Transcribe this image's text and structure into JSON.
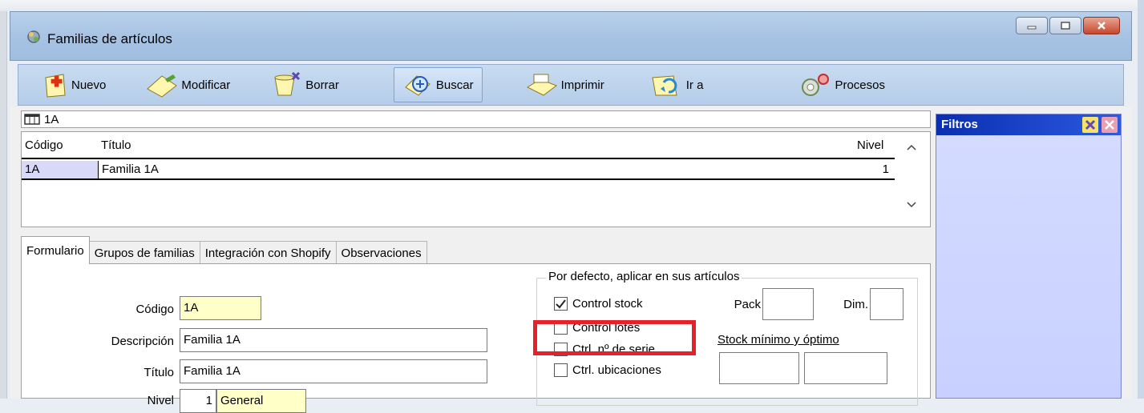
{
  "window": {
    "title": "Familias de artículos"
  },
  "toolbar": {
    "nuevo": "Nuevo",
    "modificar": "Modificar",
    "borrar": "Borrar",
    "buscar": "Buscar",
    "imprimir": "Imprimir",
    "ir_a": "Ir a",
    "procesos": "Procesos"
  },
  "search": {
    "value": "1A"
  },
  "grid": {
    "headers": {
      "codigo": "Código",
      "titulo": "Título",
      "nivel": "Nivel"
    },
    "rows": [
      {
        "codigo": "1A",
        "titulo": "Familia 1A",
        "nivel": "1"
      }
    ]
  },
  "filters": {
    "title": "Filtros"
  },
  "tabs": [
    "Formulario",
    "Grupos de familias",
    "Integración con Shopify",
    "Observaciones"
  ],
  "form": {
    "codigo_label": "Código",
    "codigo_value": "1A",
    "descripcion_label": "Descripción",
    "descripcion_value": "Familia 1A",
    "titulo_label": "Título",
    "titulo_value": "Familia 1A",
    "nivel_label": "Nivel",
    "nivel_value": "1",
    "nivel_name": "General"
  },
  "defaults_group": {
    "title": "Por defecto, aplicar en sus artículos",
    "control_stock": {
      "label": "Control stock",
      "checked": true
    },
    "control_lotes": {
      "label": "Control lotes",
      "checked": false
    },
    "ctrl_serie": {
      "label": "Ctrl. nº de serie",
      "checked": false
    },
    "ctrl_ubicaciones": {
      "label": "Ctrl. ubicaciones",
      "checked": false
    },
    "pack_label": "Pack",
    "dim_label": "Dim.",
    "stock_label": "Stock mínimo y óptimo"
  },
  "colors": {
    "highlight": "#e8202a",
    "filters_header": "#0a2eb0",
    "code_field_bg": "#ffffc8"
  }
}
